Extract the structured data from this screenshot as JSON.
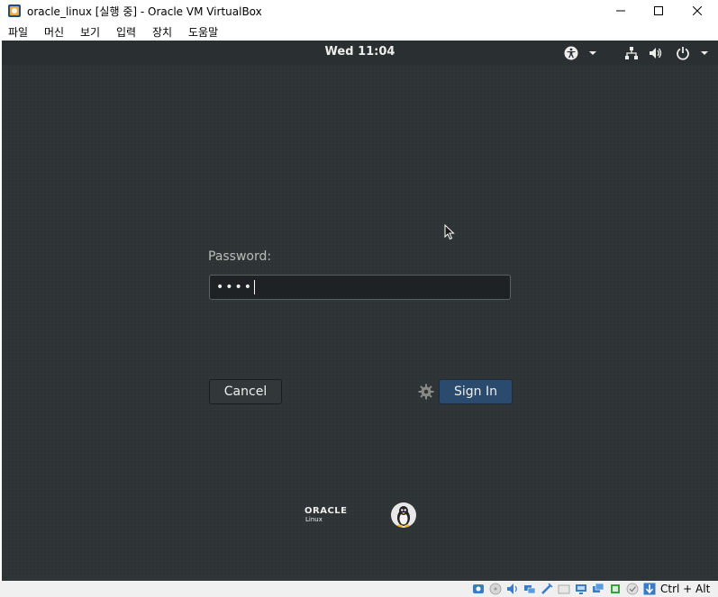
{
  "window": {
    "title": "oracle_linux [실행 중] - Oracle VM VirtualBox"
  },
  "menubar": {
    "items": [
      "파일",
      "머신",
      "보기",
      "입력",
      "장치",
      "도움말"
    ]
  },
  "vm": {
    "clock": "Wed 11:04",
    "password_label": "Password:",
    "password_value": "••••",
    "cancel_label": "Cancel",
    "signin_label": "Sign In",
    "logo_main": "ORACLE",
    "logo_sub": "Linux"
  },
  "statusbar": {
    "host_key": "Ctrl + Alt"
  },
  "colors": {
    "desktop_bg": "#2e3436",
    "signin_button": "#2b4b6e",
    "text_light": "#eeeeec"
  }
}
